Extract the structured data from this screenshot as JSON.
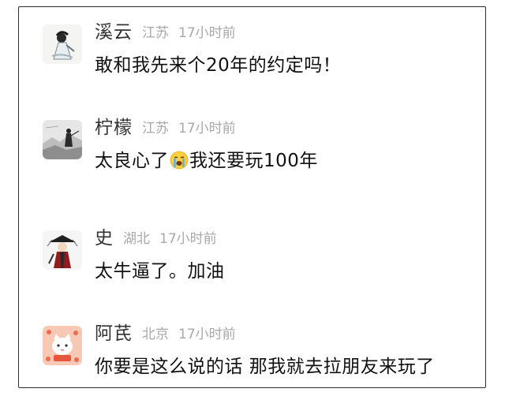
{
  "comments": [
    {
      "name": "溪云",
      "location": "江苏",
      "time": "17小时前",
      "text": "敢和我先来个20年的约定吗！",
      "avatar_icon": "ink-figure-avatar-icon"
    },
    {
      "name": "柠檬",
      "location": "江苏",
      "time": "17小时前",
      "text_before": "太良心了",
      "emoji_icon": "loudly-crying-face-icon",
      "text_after": "我还要玩100年",
      "avatar_icon": "landscape-swordsman-avatar-icon"
    },
    {
      "name": "史",
      "location": "湖北",
      "time": "17小时前",
      "text": "太牛逼了。加油",
      "avatar_icon": "hat-warrior-avatar-icon"
    },
    {
      "name": "阿芪",
      "location": "北京",
      "time": "17小时前",
      "text": "你要是这么说的话 那我就去拉朋友来玩了",
      "avatar_icon": "cartoon-cat-avatar-icon"
    }
  ],
  "colors": {
    "name": "#333333",
    "meta": "#a8a8a8",
    "text": "#111111",
    "border": "#2b2b2b"
  }
}
